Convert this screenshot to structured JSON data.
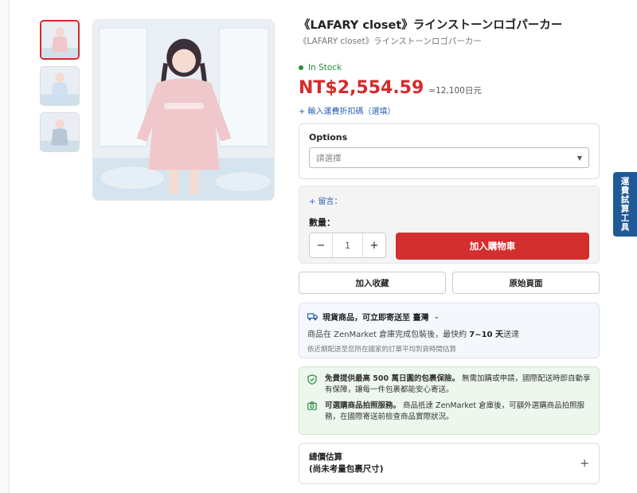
{
  "product": {
    "title": "《LAFARY closet》ラインストーンロゴパーカー",
    "subtitle": "《LAFARY closet》ラインストーンロゴパーカー",
    "stock_status": "In Stock",
    "price": "NT$2,554.59",
    "price_yen": "≈12,100日元",
    "coupon_link": "+ 輸入運費折扣碼（選填）"
  },
  "images": {
    "thumbnail_colors": [
      "#f0c8cc",
      "#cfe0f2",
      "#b9c6d6"
    ]
  },
  "options": {
    "label": "Options",
    "select_placeholder": "請選擇"
  },
  "cart": {
    "note_link": "+ 留言：",
    "quantity_label": "數量：",
    "minus": "−",
    "quantity": "1",
    "plus": "+",
    "add_to_cart": "加入購物車"
  },
  "actions": {
    "favorite": "加入收藏",
    "original_page": "原始頁面"
  },
  "shipping": {
    "heading": "現貨商品，可立即寄送至 臺灣",
    "line_prefix": "商品在 ZenMarket 倉庫完成包裝後，最快約 ",
    "line_bold": "7~10 天",
    "line_suffix": "送達",
    "sub": "依近期配送至您所在國家的訂單平均到貨時間估算"
  },
  "protection": {
    "insurance_bold": "免費提供最高 500 萬日圓的包裹保險。",
    "insurance_text": " 無需加購或申請，國際配送時即自動享有保障，讓每一件包裹都能安心寄送。",
    "photo_bold": "可選購商品拍照服務。",
    "photo_text": " 商品抵達 ZenMarket 倉庫後，可額外選購商品拍照服務，在國際寄送前檢查商品實際狀況。"
  },
  "total": {
    "line1": "總價估算",
    "line2": "(尚未考量包裹尺寸)",
    "expand": "+"
  },
  "side_tab": {
    "label": "運費試算工具"
  },
  "colors": {
    "accent_red": "#d32f2f",
    "link_blue": "#2a5fb3",
    "stock_green": "#2a8a3e"
  }
}
